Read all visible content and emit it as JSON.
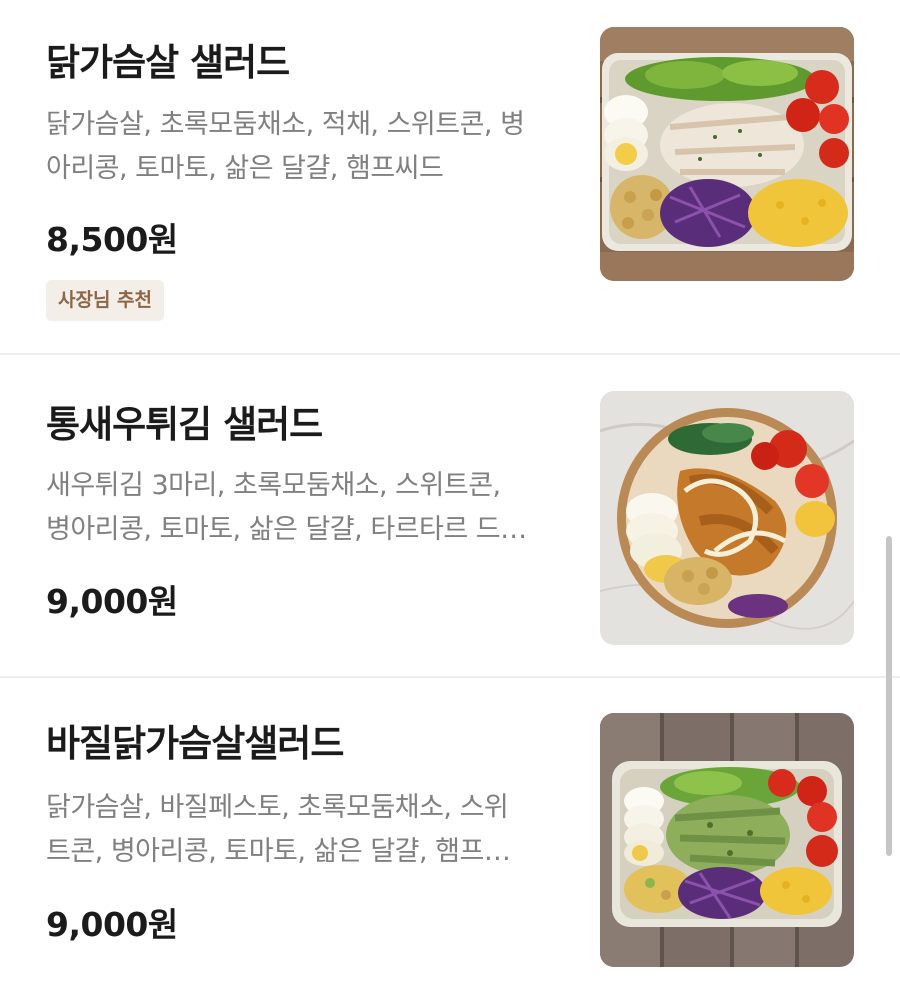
{
  "menu_items": [
    {
      "name": "닭가슴살 샐러드",
      "description_lines": [
        "닭가슴살, 초록모둠채소, 적채, 스위트콘, 병",
        "아리콩, 토마토, 삶은 달걀, 햄프씨드"
      ],
      "price": "8,500원",
      "badge": "사장님 추천",
      "image_icon": "chicken-breast-salad-photo"
    },
    {
      "name": "통새우튀김 샐러드",
      "description_lines": [
        "새우튀김 3마리, 초록모둠채소,  스위트콘,",
        "병아리콩, 토마토, 삶은 달걀, 타르타르 드…"
      ],
      "price": "9,000원",
      "image_icon": "fried-shrimp-salad-photo"
    },
    {
      "name": "바질닭가슴살샐러드",
      "description_lines": [
        "닭가슴살, 바질페스토, 초록모둠채소,  스위",
        "트콘, 병아리콩, 토마토, 삶은 달걀, 햄프…"
      ],
      "price": "9,000원",
      "image_icon": "basil-chicken-salad-photo"
    }
  ],
  "colors": {
    "title": "#1b1b1b",
    "description": "#808080",
    "badge_background": "#f4eee8",
    "badge_text": "#8d6645",
    "divider": "#efefef",
    "scrollbar": "#c6c6c6"
  }
}
